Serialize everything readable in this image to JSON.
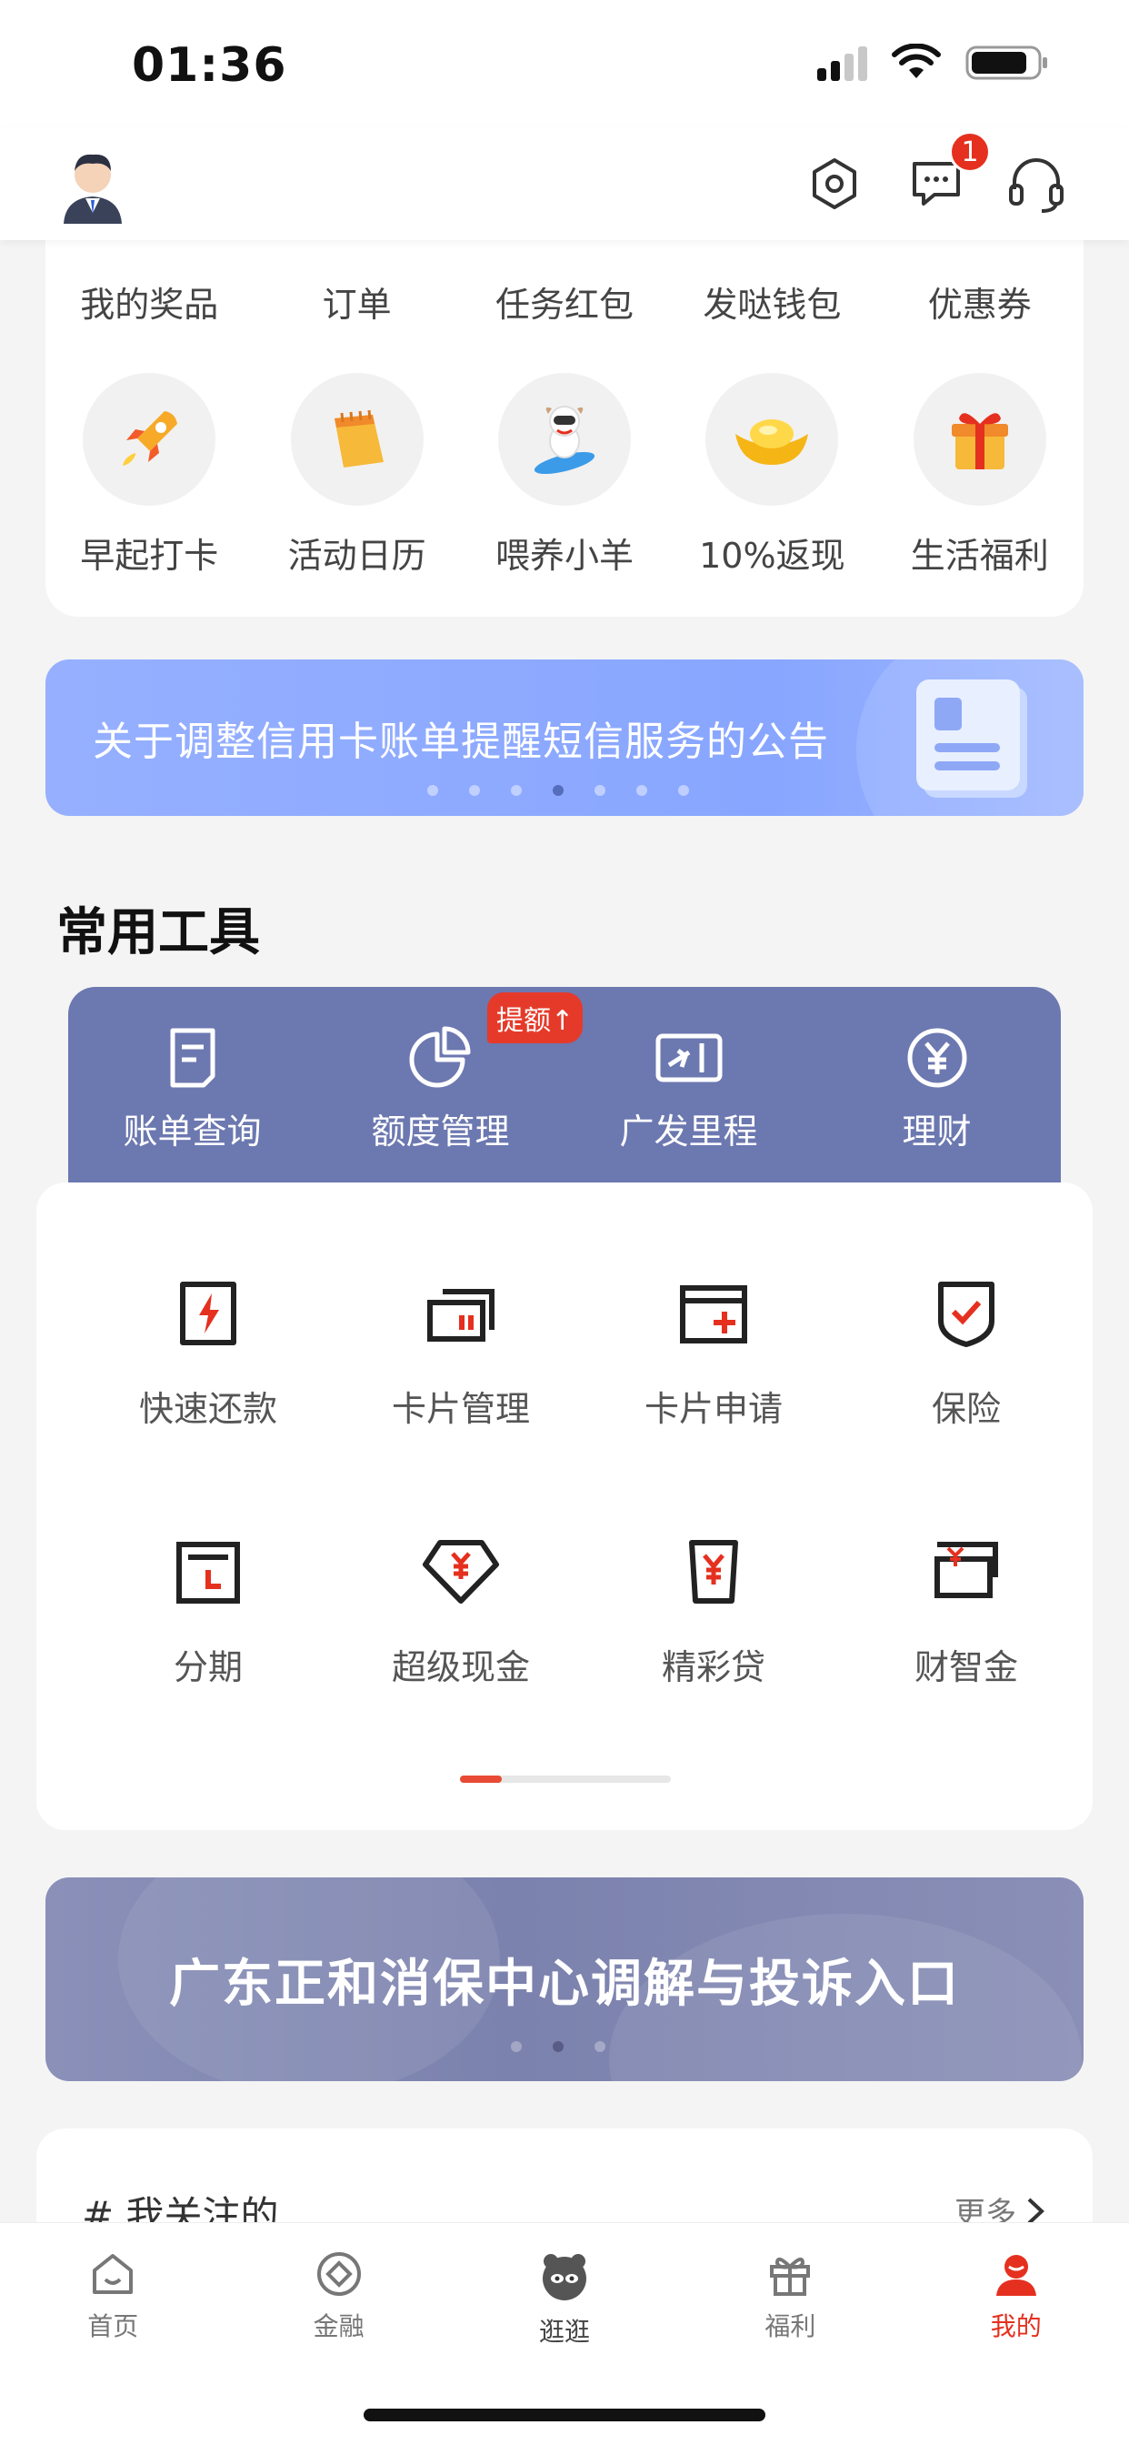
{
  "status": {
    "time": "01:36"
  },
  "header": {
    "message_badge": "1"
  },
  "quick_access": {
    "row1": [
      "我的奖品",
      "订单",
      "任务红包",
      "发哒钱包",
      "优惠券"
    ],
    "row2": [
      "早起打卡",
      "活动日历",
      "喂养小羊",
      "10%返现",
      "生活福利"
    ]
  },
  "announcement": {
    "text": "关于调整信用卡账单提醒短信服务的公告",
    "dot_count": 7,
    "active_dot": 4
  },
  "tools": {
    "title": "常用工具",
    "top": [
      "账单查询",
      "额度管理",
      "广发里程",
      "理财"
    ],
    "promo_tag": "提额↑",
    "grid_row1": [
      "快速还款",
      "卡片管理",
      "卡片申请",
      "保险"
    ],
    "grid_row2": [
      "分期",
      "超级现金",
      "精彩贷",
      "财智金"
    ]
  },
  "complaint_banner": {
    "text": "广东正和消保中心调解与投诉入口",
    "dot_count": 3,
    "active_dot": 1
  },
  "followed": {
    "title": "# 我关注的",
    "more": "更多"
  },
  "tabs": [
    "首页",
    "金融",
    "逛逛",
    "福利",
    "我的"
  ],
  "colors": {
    "accent_red": "#e5301f",
    "tools_bar": "#6c78b0",
    "announce_blue": "#8ea9ff",
    "complaint_bg": "#7f86b2"
  }
}
